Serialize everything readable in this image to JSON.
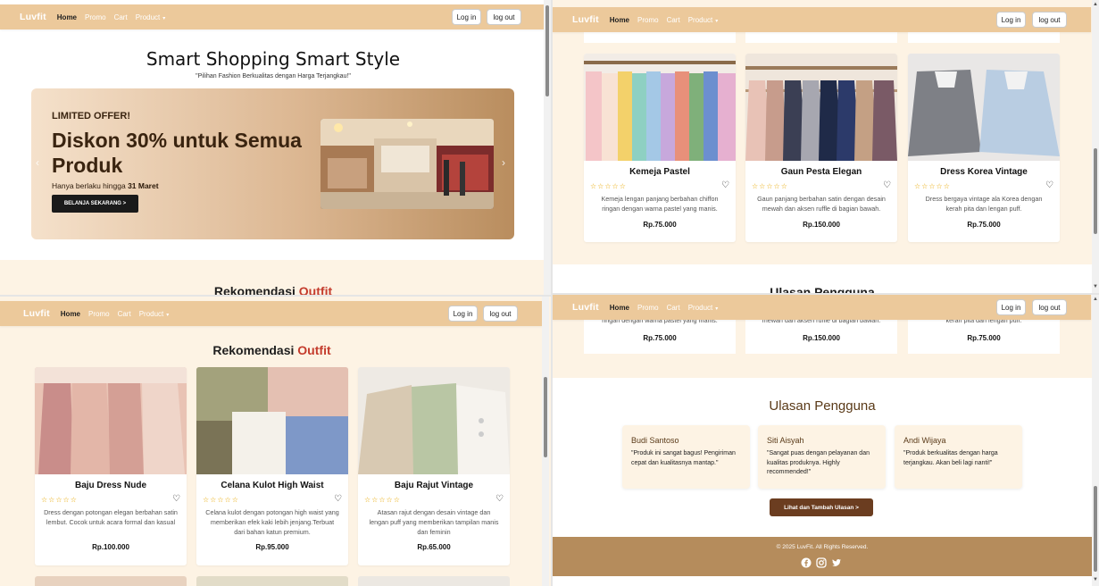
{
  "brand": "Luvfit",
  "nav": {
    "home": "Home",
    "promo": "Promo",
    "cart": "Cart",
    "product": "Product",
    "caret": "▾",
    "login": "Log in",
    "logout": "log out"
  },
  "hero": {
    "title": "Smart Shopping Smart Style",
    "subtitle": "\"Pilihan Fashion Berkualitas dengan Harga Terjangkau!\"",
    "tag": "LIMITED OFFER!",
    "heading": "Diskon 30% untuk Semua Produk",
    "note_prefix": "Hanya berlaku hingga ",
    "note_date": "31 Maret",
    "cta": "BELANJA SEKARANG >",
    "prev": "‹",
    "next": "›"
  },
  "recommend": {
    "title_a": "Rekomendasi ",
    "title_b": "Outfit"
  },
  "recommend_cut": {
    "title_a": "Rekomendasi ",
    "title_b": "Outfit"
  },
  "cut_title_tr": "Ulasan Pengguna",
  "stars": "☆☆☆☆☆",
  "heart": "♡",
  "products_rec": [
    {
      "name": "Baju Dress Nude",
      "desc": "Dress dengan potongan elegan berbahan satin lembut. Cocok untuk acara formal dan kasual",
      "price": "Rp.100.000"
    },
    {
      "name": "Celana Kulot High Waist",
      "desc": "Celana kulot dengan potongan high waist yang memberikan efek kaki lebih jenjang.Terbuat dari bahan katun premium.",
      "price": "Rp.95.000"
    },
    {
      "name": "Baju Rajut Vintage",
      "desc": "Atasan rajut dengan desain vintage dan lengan puff yang memberikan tampilan manis dan feminin",
      "price": "Rp.65.000"
    }
  ],
  "products_more": [
    {
      "name": "Kemeja Pastel",
      "desc": "Kemeja lengan panjang berbahan chiffon ringan dengan warna pastel yang manis.",
      "price": "Rp.75.000",
      "desc_cut": "ringan dengan warna pastel yang manis."
    },
    {
      "name": "Gaun Pesta Elegan",
      "desc": "Gaun panjang berbahan satin dengan desain mewah dan aksen ruffle di bagian bawah.",
      "price": "Rp.150.000",
      "desc_cut": "mewah dan aksen ruffle di bagian bawah."
    },
    {
      "name": "Dress Korea Vintage",
      "desc": "Dress bergaya vintage ala Korea dengan kerah pita dan lengan puff.",
      "price": "Rp.75.000",
      "desc_cut": "kerah pita dan lengan puff."
    }
  ],
  "reviews": {
    "title": "Ulasan Pengguna",
    "items": [
      {
        "name": "Budi Santoso",
        "text": "\"Produk ini sangat bagus! Pengiriman cepat dan kualitasnya mantap.\""
      },
      {
        "name": "Siti Aisyah",
        "text": "\"Sangat puas dengan pelayanan dan kualitas produknya. Highly recommended!\""
      },
      {
        "name": "Andi Wijaya",
        "text": "\"Produk berkualitas dengan harga terjangkau. Akan beli lagi nanti!\""
      }
    ],
    "cta": "Lihat dan Tambah Ulasan >"
  },
  "footer": {
    "copyright": "© 2025 LuvFit. All Rights Reserved.",
    "icons": [
      "facebook-icon",
      "instagram-icon",
      "twitter-icon"
    ]
  },
  "colors": {
    "nav": "#ecc99b",
    "cream": "#fdf3e4",
    "accent": "#c43b2c",
    "footer": "#b58c5c",
    "button_dark": "#6b3d20"
  }
}
